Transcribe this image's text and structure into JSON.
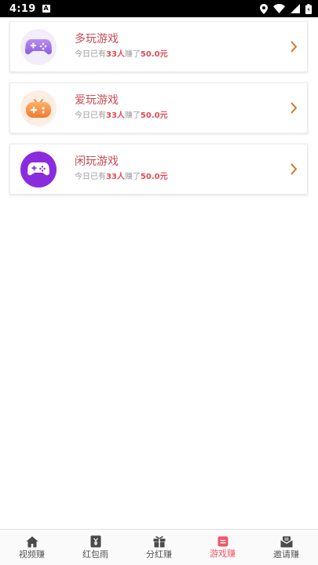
{
  "status_bar": {
    "time": "4:19",
    "notification_glyph": "A"
  },
  "games": [
    {
      "title": "多玩游戏",
      "sub_prefix": "今日已有",
      "people": "33人",
      "sub_mid": "赚了",
      "amount": "50.0元",
      "icon": "purple-gamepad-icon"
    },
    {
      "title": "爱玩游戏",
      "sub_prefix": "今日已有",
      "people": "33人",
      "sub_mid": "赚了",
      "amount": "50.0元",
      "icon": "orange-gamepad-icon"
    },
    {
      "title": "闲玩游戏",
      "sub_prefix": "今日已有",
      "people": "33人",
      "sub_mid": "赚了",
      "amount": "50.0元",
      "icon": "white-gamepad-icon"
    }
  ],
  "tabbar": {
    "active_index": 3,
    "items": [
      {
        "label": "视频赚",
        "icon": "home-icon"
      },
      {
        "label": "红包雨",
        "icon": "red-envelope-icon"
      },
      {
        "label": "分红赚",
        "icon": "gift-icon"
      },
      {
        "label": "游戏赚",
        "icon": "game-doc-icon"
      },
      {
        "label": "邀请赚",
        "icon": "mail-icon"
      }
    ]
  },
  "colors": {
    "title": "#c94a55",
    "highlight": "#e04b55",
    "chevron": "#d9731f",
    "active_tab": "#f0566a",
    "inactive_tab": "#555555"
  }
}
